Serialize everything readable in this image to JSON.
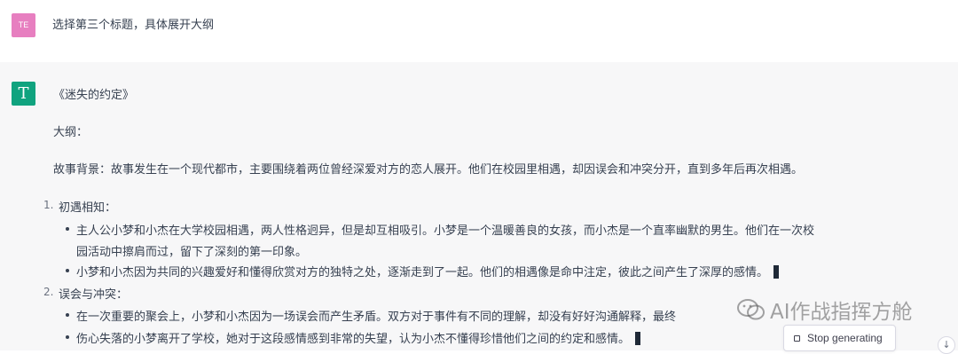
{
  "user_message": {
    "avatar_initials": "TE",
    "text": "选择第三个标题，具体展开大纲"
  },
  "assistant_message": {
    "avatar_letter": "T",
    "title": "《迷失的约定》",
    "outline_label": "大纲：",
    "background": "故事背景：故事发生在一个现代都市，主要围绕着两位曾经深爱对方的恋人展开。他们在校园里相遇，却因误会和冲突分开，直到多年后再次相遇。",
    "sections": [
      {
        "number": "1.",
        "heading": "初遇相知：",
        "bullets": [
          [
            "主人公小梦和小杰在大学校园相遇，两人性格迥异，但是却互相吸引。小梦是一个温暖善良的女孩，而小杰是一个直率幽默的男生。他们在一次校",
            "园活动中擦肩而过，留下了深刻的第一印象。"
          ],
          [
            "小梦和小杰因为共同的兴趣爱好和懂得欣赏对方的独特之处，逐渐走到了一起。他们的相遇像是命中注定，彼此之间产生了深厚的感情。"
          ]
        ]
      },
      {
        "number": "2.",
        "heading": "误会与冲突：",
        "bullets": [
          [
            "在一次重要的聚会上，小梦和小杰因为一场误会而产生矛盾。双方对于事件有不同的理解，却没有好好沟通解释，最终"
          ],
          [
            "伤心失落的小梦离开了学校，她对于这段感情感到非常的失望，认为小杰不懂得珍惜他们之间的约定和感情。"
          ]
        ]
      }
    ]
  },
  "watermark": {
    "text": "AI作战指挥方舱"
  },
  "controls": {
    "stop_label": "Stop generating",
    "scroll_down_icon": "arrow-down-icon"
  },
  "colors": {
    "user_avatar": "#e77fc0",
    "bot_avatar": "#10a37f",
    "assistant_bg": "#f7f7f8"
  }
}
